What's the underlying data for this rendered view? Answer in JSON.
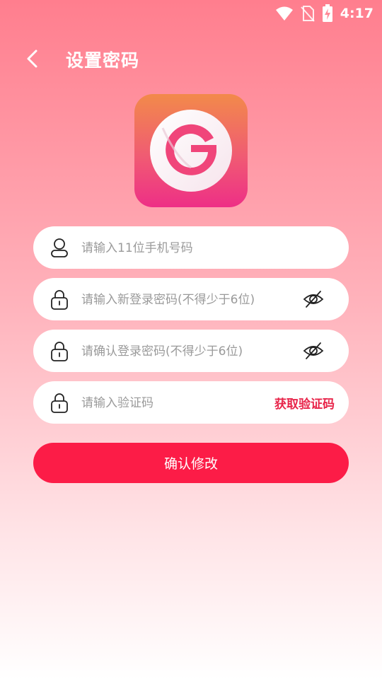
{
  "status_bar": {
    "time": "4:17",
    "icons": [
      "wifi-icon",
      "no-sim-icon",
      "battery-charging-icon"
    ]
  },
  "header": {
    "title": "设置密码",
    "back_icon": "chevron-left-icon"
  },
  "logo": {
    "letter": "G",
    "colors": [
      "#f28a4a",
      "#ee2f86"
    ]
  },
  "form": {
    "phone": {
      "placeholder": "请输入11位手机号码",
      "value": "",
      "icon": "user-icon"
    },
    "new_password": {
      "placeholder": "请输入新登录密码(不得少于6位)",
      "value": "",
      "icon": "lock-icon",
      "toggle_icon": "eye-off-icon"
    },
    "confirm_password": {
      "placeholder": "请确认登录密码(不得少于6位)",
      "value": "",
      "icon": "lock-icon",
      "toggle_icon": "eye-off-icon"
    },
    "code": {
      "placeholder": "请输入验证码",
      "value": "",
      "icon": "lock-icon",
      "get_code_label": "获取验证码"
    },
    "submit_label": "确认修改"
  },
  "colors": {
    "accent": "#fc1c47",
    "link": "#e8254a"
  }
}
